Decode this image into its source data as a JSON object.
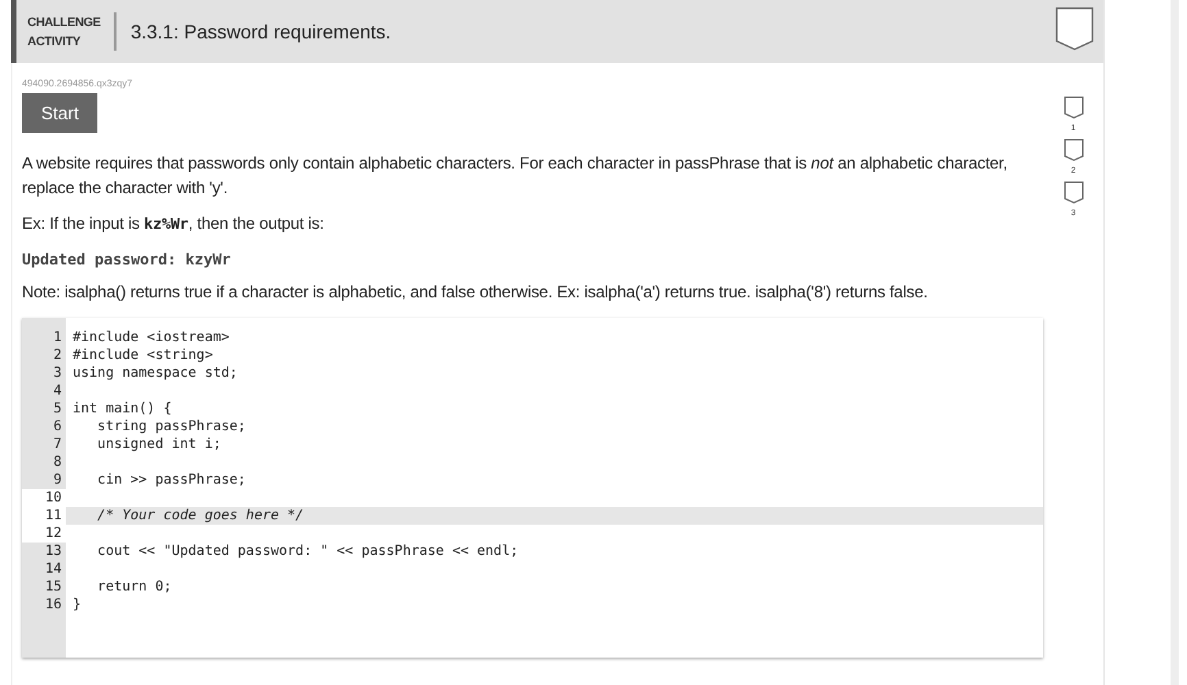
{
  "header": {
    "badge": [
      "CHALLENGE",
      "ACTIVITY"
    ],
    "title": "3.3.1: Password requirements."
  },
  "activity_id": "494090.2694856.qx3zqy7",
  "start_button": "Start",
  "instructions": [
    {
      "kind": "paragraph",
      "text": "A website requires that passwords only contain alphabetic characters. For each character in passPhrase that is *not* an alphabetic character, replace the character with 'y'."
    },
    {
      "kind": "example",
      "before": "Ex: If the input is ",
      "code": "kz%Wr",
      "after": ", then the output is:"
    },
    {
      "kind": "output",
      "text": "Updated password: kzyWr"
    },
    {
      "kind": "paragraph",
      "text": "Note: isalpha() returns true if a character is alphabetic, and false otherwise. Ex: isalpha('a') returns true. isalpha('8') returns false."
    }
  ],
  "levels": [
    {
      "number": "1",
      "completed": false
    },
    {
      "number": "2",
      "completed": false
    },
    {
      "number": "3",
      "completed": false
    }
  ],
  "code_lines": [
    {
      "number": "1",
      "text": "#include <iostream>",
      "editable": false,
      "highlighted": false
    },
    {
      "number": "2",
      "text": "#include <string>",
      "editable": false,
      "highlighted": false
    },
    {
      "number": "3",
      "text": "using namespace std;",
      "editable": false,
      "highlighted": false
    },
    {
      "number": "4",
      "editable": false,
      "highlighted": false
    },
    {
      "number": "5",
      "text": "int main() {",
      "editable": false,
      "highlighted": false
    },
    {
      "number": "6",
      "text": "   string passPhrase;",
      "editable": false,
      "highlighted": false
    },
    {
      "number": "7",
      "text": "   unsigned int i;",
      "editable": false,
      "highlighted": false
    },
    {
      "number": "8",
      "editable": false,
      "highlighted": false
    },
    {
      "number": "9",
      "text": "   cin >> passPhrase;",
      "editable": false,
      "highlighted": false
    },
    {
      "number": "10",
      "editable": true,
      "highlighted": false
    },
    {
      "number": "11",
      "text": "   /* Your code goes here */",
      "editable": true,
      "highlighted": true
    },
    {
      "number": "12",
      "editable": true,
      "highlighted": false
    },
    {
      "number": "13",
      "text": "   cout << \"Updated password: \" << passPhrase << endl;",
      "editable": false,
      "highlighted": false
    },
    {
      "number": "14",
      "editable": false,
      "highlighted": false
    },
    {
      "number": "15",
      "text": "   return 0;",
      "editable": false,
      "highlighted": false
    },
    {
      "number": "16",
      "text": "}",
      "editable": false,
      "highlighted": false
    }
  ]
}
